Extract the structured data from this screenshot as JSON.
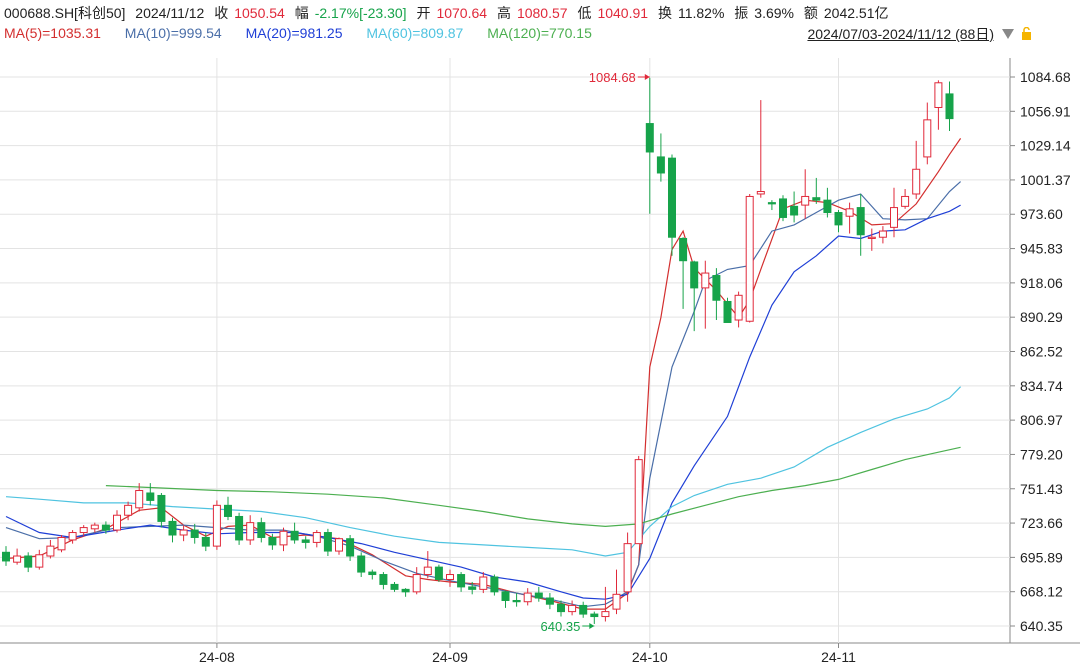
{
  "header": {
    "symbol": "000688.SH[科创50]",
    "date": "2024/11/12",
    "close_label": "收",
    "close": "1050.54",
    "change_label": "幅",
    "change": "-2.17%[-23.30]",
    "open_label": "开",
    "open": "1070.64",
    "high_label": "高",
    "high": "1080.57",
    "low_label": "低",
    "low": "1040.91",
    "turnover_label": "换",
    "turnover": "11.82%",
    "amplitude_label": "振",
    "amplitude": "3.69%",
    "amount_label": "额",
    "amount": "2042.51亿",
    "range": "2024/07/03-2024/11/12 (88日)"
  },
  "ma_legend": [
    {
      "text": "MA(5)=1035.31",
      "color": "#d32f2f"
    },
    {
      "text": "MA(10)=999.54",
      "color": "#4a6ea8"
    },
    {
      "text": "MA(20)=981.25",
      "color": "#1f3fd6"
    },
    {
      "text": "MA(60)=809.87",
      "color": "#4fc3e0"
    },
    {
      "text": "MA(120)=770.15",
      "color": "#4caf50"
    }
  ],
  "colors": {
    "up": "#e0293a",
    "down": "#16a34a",
    "grid": "#e3e3e3"
  },
  "chart_data": {
    "type": "candlestick",
    "y_ticks": [
      "1084.68",
      "1056.91",
      "1029.14",
      "1001.37",
      "973.60",
      "945.83",
      "918.06",
      "890.29",
      "862.52",
      "834.74",
      "806.97",
      "779.20",
      "751.43",
      "723.66",
      "695.89",
      "668.12",
      "640.35"
    ],
    "ylim": [
      640.35,
      1084.68
    ],
    "x_ticks": [
      {
        "label": "24-08",
        "index": 19
      },
      {
        "label": "24-09",
        "index": 40
      },
      {
        "label": "24-10",
        "index": 58
      },
      {
        "label": "24-11",
        "index": 75
      }
    ],
    "annotations": [
      {
        "label": "1084.68",
        "index": 58,
        "value": 1084.68
      },
      {
        "label": "640.35",
        "index": 53,
        "value": 640.35
      }
    ],
    "candles": [
      [
        700,
        693,
        705,
        689
      ],
      [
        692,
        697,
        703,
        690
      ],
      [
        697,
        688,
        700,
        684
      ],
      [
        688,
        698,
        702,
        686
      ],
      [
        697,
        705,
        710,
        695
      ],
      [
        702,
        712,
        714,
        700
      ],
      [
        710,
        716,
        718,
        707
      ],
      [
        716,
        720,
        722,
        713
      ],
      [
        719,
        722,
        724,
        716
      ],
      [
        722,
        718,
        725,
        715
      ],
      [
        718,
        730,
        734,
        716
      ],
      [
        730,
        738,
        741,
        726
      ],
      [
        736,
        750,
        756,
        733
      ],
      [
        748,
        742,
        756,
        738
      ],
      [
        746,
        725,
        748,
        720
      ],
      [
        725,
        714,
        728,
        708
      ],
      [
        714,
        718,
        722,
        709
      ],
      [
        718,
        712,
        723,
        707
      ],
      [
        712,
        705,
        716,
        701
      ],
      [
        705,
        738,
        742,
        702
      ],
      [
        738,
        729,
        745,
        726
      ],
      [
        729,
        710,
        732,
        706
      ],
      [
        710,
        724,
        730,
        706
      ],
      [
        724,
        712,
        728,
        708
      ],
      [
        712,
        706,
        715,
        702
      ],
      [
        706,
        717,
        720,
        701
      ],
      [
        717,
        710,
        724,
        707
      ],
      [
        710,
        708,
        713,
        703
      ],
      [
        708,
        716,
        718,
        704
      ],
      [
        716,
        701,
        719,
        697
      ],
      [
        701,
        711,
        712,
        698
      ],
      [
        711,
        697,
        714,
        693
      ],
      [
        697,
        684,
        700,
        680
      ],
      [
        684,
        682,
        686,
        678
      ],
      [
        682,
        674,
        684,
        670
      ],
      [
        674,
        670,
        676,
        668
      ],
      [
        670,
        668,
        671,
        664
      ],
      [
        668,
        682,
        688,
        666
      ],
      [
        682,
        688,
        701,
        679
      ],
      [
        688,
        678,
        690,
        676
      ],
      [
        678,
        682,
        686,
        672
      ],
      [
        682,
        672,
        684,
        668
      ],
      [
        672,
        670,
        676,
        666
      ],
      [
        670,
        680,
        684,
        667
      ],
      [
        680,
        668,
        682,
        665
      ],
      [
        668,
        661,
        669,
        655
      ],
      [
        661,
        660,
        667,
        656
      ],
      [
        660,
        667,
        671,
        657
      ],
      [
        667,
        663,
        672,
        660
      ],
      [
        663,
        658,
        667,
        654
      ],
      [
        658,
        652,
        661,
        648
      ],
      [
        652,
        657,
        661,
        649
      ],
      [
        657,
        650,
        660,
        647
      ],
      [
        650,
        648,
        652,
        642
      ],
      [
        648,
        652,
        672,
        644
      ],
      [
        654,
        666,
        686,
        650
      ],
      [
        668,
        707,
        716,
        660
      ],
      [
        707,
        775,
        778,
        770
      ],
      [
        1047,
        1024,
        1084,
        974
      ],
      [
        1020,
        1007,
        1039,
        1000
      ],
      [
        1019,
        955,
        1022,
        940
      ],
      [
        954,
        936,
        955,
        897
      ],
      [
        935,
        914,
        936,
        879
      ],
      [
        914,
        926,
        936,
        881
      ],
      [
        924,
        904,
        930,
        888
      ],
      [
        903,
        886,
        906,
        887
      ],
      [
        888,
        908,
        911,
        882
      ],
      [
        887,
        988,
        990,
        886
      ],
      [
        990,
        992,
        1066,
        987
      ],
      [
        983,
        982,
        985,
        977
      ],
      [
        986,
        971,
        989,
        968
      ],
      [
        980,
        973,
        992,
        967
      ],
      [
        981,
        988,
        1010,
        970
      ],
      [
        987,
        985,
        1003,
        982
      ],
      [
        985,
        975,
        995,
        971
      ],
      [
        975,
        965,
        977,
        959
      ],
      [
        972,
        978,
        983,
        958
      ],
      [
        979,
        957,
        990,
        940
      ],
      [
        954,
        955,
        962,
        944
      ],
      [
        955,
        960,
        964,
        950
      ],
      [
        963,
        979,
        995,
        955
      ],
      [
        980,
        988,
        994,
        978
      ],
      [
        990,
        1010,
        1033,
        986
      ],
      [
        1020,
        1050,
        1064,
        1014
      ],
      [
        1060,
        1080,
        1082,
        1042
      ],
      [
        1071,
        1051,
        1081,
        1041
      ]
    ],
    "ma_series": [
      {
        "name": "MA(5)",
        "values": [
          [
            0,
            695
          ],
          [
            3,
            697
          ],
          [
            6,
            710
          ],
          [
            9,
            719
          ],
          [
            12,
            734
          ],
          [
            14,
            736
          ],
          [
            16,
            722
          ],
          [
            18,
            713
          ],
          [
            20,
            721
          ],
          [
            22,
            722
          ],
          [
            24,
            712
          ],
          [
            27,
            714
          ],
          [
            30,
            711
          ],
          [
            33,
            698
          ],
          [
            36,
            681
          ],
          [
            38,
            678
          ],
          [
            40,
            676
          ],
          [
            43,
            674
          ],
          [
            46,
            667
          ],
          [
            49,
            661
          ],
          [
            52,
            654
          ],
          [
            54,
            654
          ],
          [
            56,
            667
          ],
          [
            57,
            690
          ],
          [
            58,
            850
          ],
          [
            59,
            890
          ],
          [
            60,
            945
          ],
          [
            61,
            960
          ],
          [
            62,
            930
          ],
          [
            64,
            912
          ],
          [
            66,
            890
          ],
          [
            67,
            904
          ],
          [
            68,
            929
          ],
          [
            70,
            978
          ],
          [
            72,
            985
          ],
          [
            74,
            983
          ],
          [
            76,
            976
          ],
          [
            78,
            965
          ],
          [
            80,
            966
          ],
          [
            82,
            982
          ],
          [
            84,
            1008
          ],
          [
            85,
            1022
          ],
          [
            86,
            1035
          ]
        ]
      },
      {
        "name": "MA(10)",
        "values": [
          [
            0,
            720
          ],
          [
            3,
            711
          ],
          [
            6,
            712
          ],
          [
            10,
            720
          ],
          [
            13,
            721
          ],
          [
            16,
            722
          ],
          [
            19,
            720
          ],
          [
            22,
            718
          ],
          [
            25,
            718
          ],
          [
            28,
            713
          ],
          [
            31,
            705
          ],
          [
            34,
            693
          ],
          [
            37,
            683
          ],
          [
            40,
            677
          ],
          [
            43,
            672
          ],
          [
            46,
            667
          ],
          [
            49,
            662
          ],
          [
            52,
            656
          ],
          [
            54,
            658
          ],
          [
            56,
            668
          ],
          [
            57,
            690
          ],
          [
            58,
            760
          ],
          [
            60,
            850
          ],
          [
            62,
            895
          ],
          [
            63,
            920
          ],
          [
            65,
            929
          ],
          [
            67,
            932
          ],
          [
            69,
            960
          ],
          [
            71,
            965
          ],
          [
            73,
            975
          ],
          [
            75,
            985
          ],
          [
            77,
            990
          ],
          [
            79,
            970
          ],
          [
            81,
            969
          ],
          [
            83,
            970
          ],
          [
            85,
            992
          ],
          [
            86,
            1000
          ]
        ]
      },
      {
        "name": "MA(20)",
        "values": [
          [
            0,
            729
          ],
          [
            3,
            716
          ],
          [
            6,
            712
          ],
          [
            10,
            718
          ],
          [
            13,
            722
          ],
          [
            16,
            718
          ],
          [
            19,
            715
          ],
          [
            22,
            716
          ],
          [
            26,
            716
          ],
          [
            29,
            712
          ],
          [
            32,
            707
          ],
          [
            35,
            700
          ],
          [
            38,
            694
          ],
          [
            41,
            688
          ],
          [
            44,
            680
          ],
          [
            47,
            676
          ],
          [
            50,
            668
          ],
          [
            52,
            663
          ],
          [
            54,
            662
          ],
          [
            56,
            666
          ],
          [
            58,
            695
          ],
          [
            60,
            740
          ],
          [
            62,
            770
          ],
          [
            65,
            810
          ],
          [
            67,
            858
          ],
          [
            69,
            900
          ],
          [
            71,
            927
          ],
          [
            73,
            940
          ],
          [
            75,
            956
          ],
          [
            77,
            954
          ],
          [
            79,
            960
          ],
          [
            81,
            961
          ],
          [
            83,
            970
          ],
          [
            85,
            976
          ],
          [
            86,
            981
          ]
        ]
      },
      {
        "name": "MA(60)",
        "values": [
          [
            0,
            745
          ],
          [
            3,
            743
          ],
          [
            7,
            740
          ],
          [
            11,
            740
          ],
          [
            15,
            737
          ],
          [
            19,
            735
          ],
          [
            23,
            733
          ],
          [
            27,
            728
          ],
          [
            31,
            720
          ],
          [
            35,
            713
          ],
          [
            39,
            708
          ],
          [
            43,
            706
          ],
          [
            47,
            704
          ],
          [
            51,
            702
          ],
          [
            54,
            697
          ],
          [
            56,
            700
          ],
          [
            58,
            721
          ],
          [
            60,
            737
          ],
          [
            62,
            746
          ],
          [
            65,
            755
          ],
          [
            68,
            760
          ],
          [
            71,
            769
          ],
          [
            74,
            785
          ],
          [
            77,
            797
          ],
          [
            80,
            808
          ],
          [
            83,
            816
          ],
          [
            85,
            825
          ],
          [
            86,
            834
          ]
        ]
      },
      {
        "name": "MA(120)",
        "values": [
          [
            9,
            754
          ],
          [
            14,
            752
          ],
          [
            19,
            750
          ],
          [
            24,
            749
          ],
          [
            29,
            747
          ],
          [
            34,
            744
          ],
          [
            39,
            738
          ],
          [
            43,
            733
          ],
          [
            47,
            727
          ],
          [
            51,
            723
          ],
          [
            54,
            721
          ],
          [
            57,
            723
          ],
          [
            60,
            731
          ],
          [
            63,
            738
          ],
          [
            66,
            745
          ],
          [
            69,
            750
          ],
          [
            72,
            754
          ],
          [
            75,
            759
          ],
          [
            78,
            767
          ],
          [
            81,
            775
          ],
          [
            84,
            781
          ],
          [
            86,
            785
          ]
        ]
      }
    ]
  }
}
